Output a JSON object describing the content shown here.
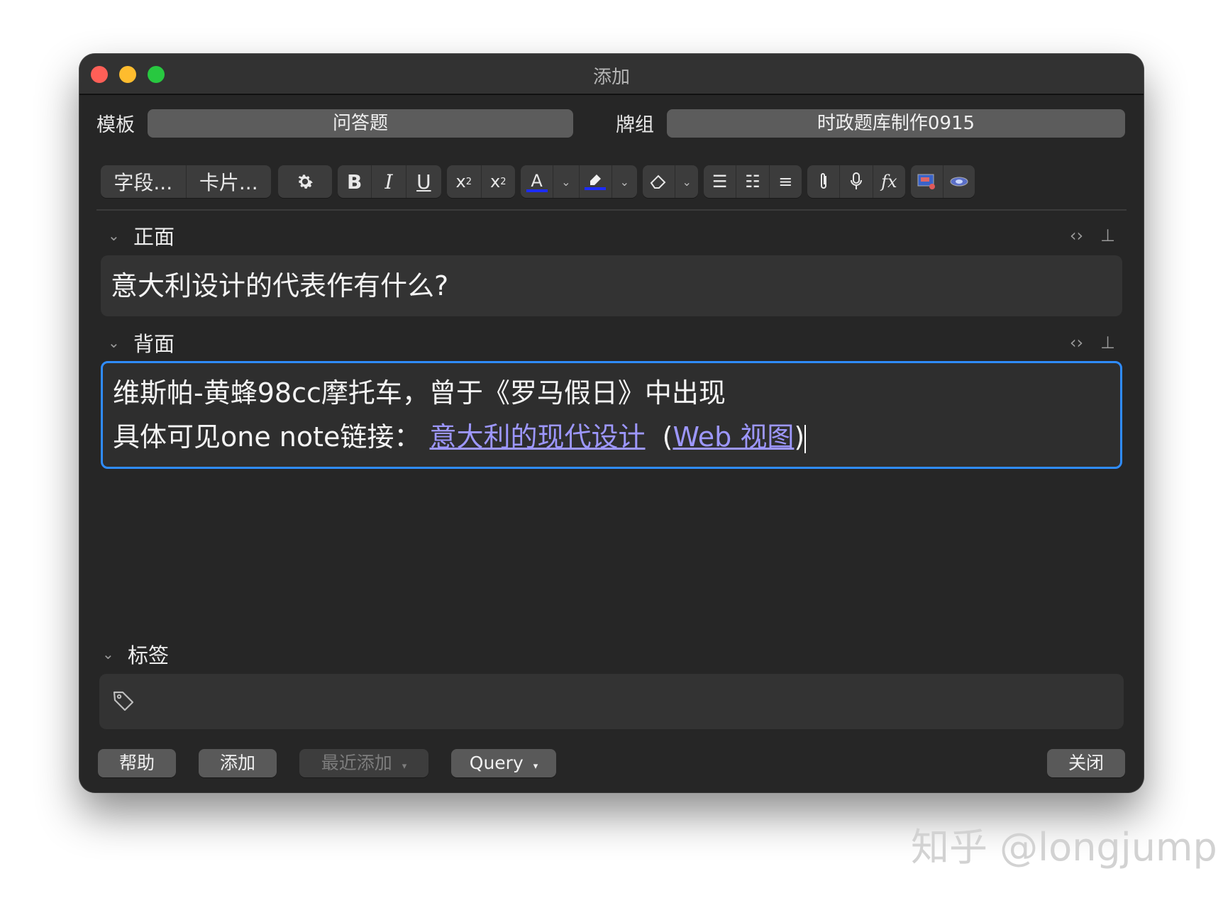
{
  "window": {
    "title": "添加"
  },
  "header": {
    "template_label": "模板",
    "template_value": "问答题",
    "deck_label": "牌组",
    "deck_value": "时政题库制作0915"
  },
  "toolbar": {
    "fields_label": "字段...",
    "cards_label": "卡片...",
    "bold": "B",
    "italic": "I",
    "underline": "U",
    "text_color_glyph": "A",
    "text_color": "#1c2cff",
    "highlight_color": "#1c2cff"
  },
  "fields": {
    "front": {
      "label": "正面",
      "content": "意大利设计的代表作有什么?"
    },
    "back": {
      "label": "背面",
      "line1": "维斯帕-黄蜂98cc摩托车，曾于《罗马假日》中出现",
      "line2_prefix": "具体可见one note链接：",
      "link1": "意大利的现代设计",
      "paren_open": "(",
      "link2": "Web 视图",
      "paren_close": ")"
    }
  },
  "tags": {
    "label": "标签"
  },
  "buttons": {
    "help": "帮助",
    "add": "添加",
    "recent": "最近添加",
    "query": "Query",
    "close": "关闭"
  },
  "watermark": "知乎 @longjump",
  "colors": {
    "accent": "#2f8cff",
    "link": "#9d97ff"
  }
}
